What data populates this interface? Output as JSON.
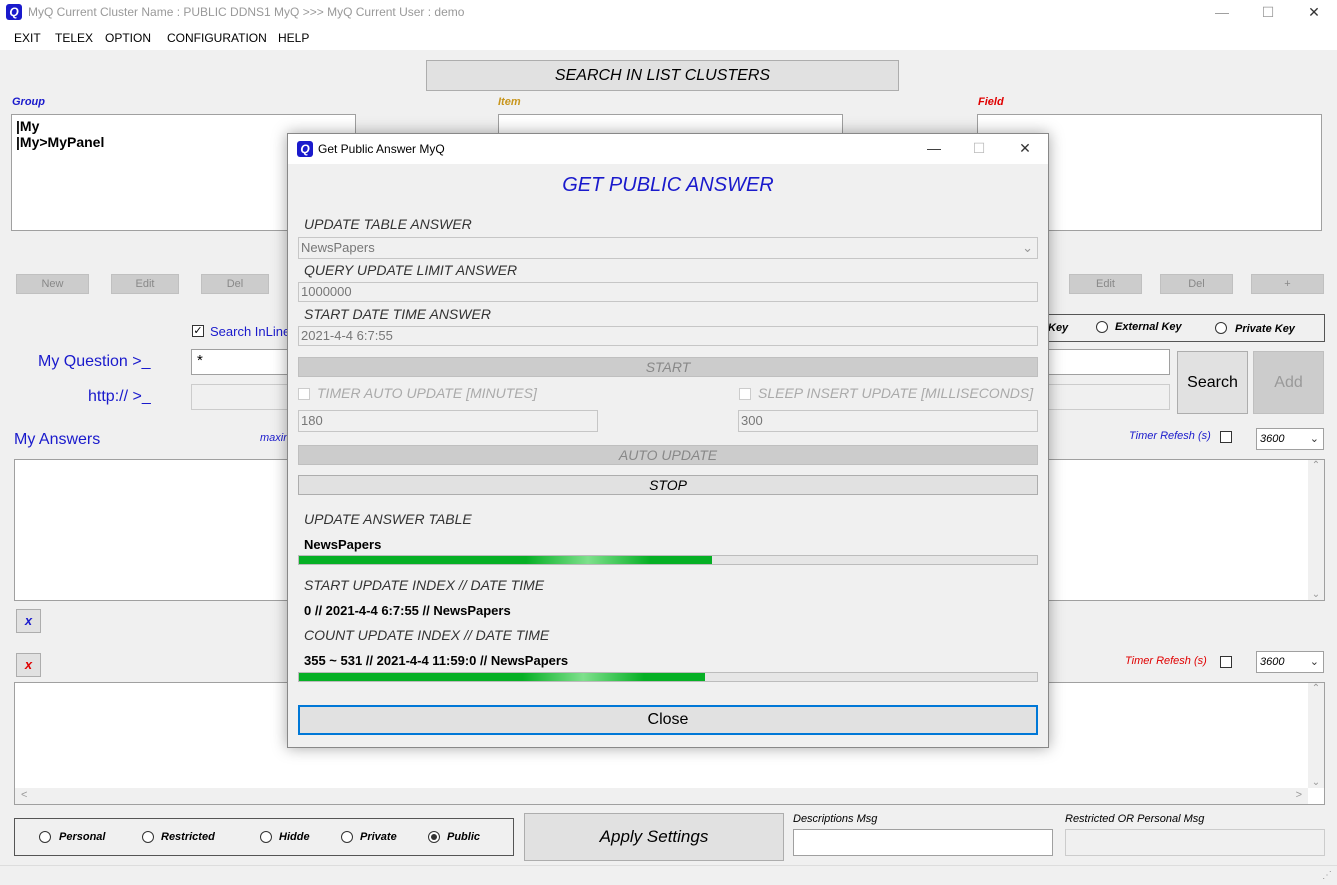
{
  "window": {
    "title": "MyQ Current Cluster Name : PUBLIC DDNS1 MyQ >>> MyQ Current User : demo",
    "icon": "Q",
    "minimize": "—",
    "maximize": "☐",
    "close": "✕"
  },
  "menu": [
    "EXIT",
    "TELEX",
    "OPTION",
    "CONFIGURATION",
    "HELP"
  ],
  "search_clusters_button": "SEARCH IN LIST CLUSTERS",
  "group": {
    "label": "Group",
    "items": [
      "|My",
      "|My>MyPanel"
    ]
  },
  "item": {
    "label": "Item"
  },
  "field": {
    "label": "Field"
  },
  "group_buttons": {
    "new": "New",
    "edit": "Edit",
    "del": "Del"
  },
  "field_buttons": {
    "edit": "Edit",
    "del": "Del",
    "plus": "+"
  },
  "search_inline": {
    "label": "Search InLine",
    "checked": true
  },
  "keys": {
    "key": "Key",
    "external": "External Key",
    "private": "Private Key"
  },
  "question": {
    "label": "My Question >_",
    "value": "*"
  },
  "http": {
    "label": "http:// >_",
    "value": ""
  },
  "search_button": "Search",
  "add_button": "Add",
  "answers": {
    "label": "My Answers",
    "max_label": "maxin"
  },
  "timer1": {
    "label": "Timer Refesh (s)",
    "value": "3600"
  },
  "timer2": {
    "label": "Timer Refesh (s)",
    "value": "3600"
  },
  "x_blue": "x",
  "x_red": "x",
  "privacy": {
    "options": [
      "Personal",
      "Restricted",
      "Hidde",
      "Private",
      "Public"
    ],
    "selected": "Public"
  },
  "apply_button": "Apply Settings",
  "descriptions_msg": {
    "label": "Descriptions Msg",
    "value": ""
  },
  "restricted_msg": {
    "label": "Restricted OR Personal Msg",
    "value": ""
  },
  "dialog": {
    "title": "Get Public Answer MyQ",
    "heading": "GET PUBLIC ANSWER",
    "update_table_label": "UPDATE TABLE ANSWER",
    "update_table_value": "NewsPapers",
    "query_limit_label": "QUERY UPDATE LIMIT ANSWER",
    "query_limit_value": "1000000",
    "start_datetime_label": "START DATE TIME ANSWER",
    "start_datetime_value": "2021-4-4 6:7:55",
    "start_button": "START",
    "timer_auto_label": "TIMER AUTO UPDATE [MINUTES]",
    "timer_auto_value": "180",
    "sleep_insert_label": "SLEEP INSERT UPDATE [MILLISECONDS]",
    "sleep_insert_value": "300",
    "auto_update_button": "AUTO UPDATE",
    "stop_button": "STOP",
    "update_answer_table_label": "UPDATE ANSWER TABLE",
    "update_answer_table_value": "NewsPapers",
    "progress1": 0.56,
    "start_index_label": "START UPDATE INDEX // DATE TIME",
    "start_index_value": "0 // 2021-4-4 6:7:55 // NewsPapers",
    "count_index_label": "COUNT UPDATE INDEX // DATE TIME",
    "count_index_value": "355 ~ 531 // 2021-4-4 11:59:0 // NewsPapers",
    "progress2": 0.55,
    "close_button": "Close"
  },
  "colors": {
    "blue": "#1a1acc",
    "red": "#e00000",
    "gold": "#c8961e",
    "progress": "#06b025"
  }
}
